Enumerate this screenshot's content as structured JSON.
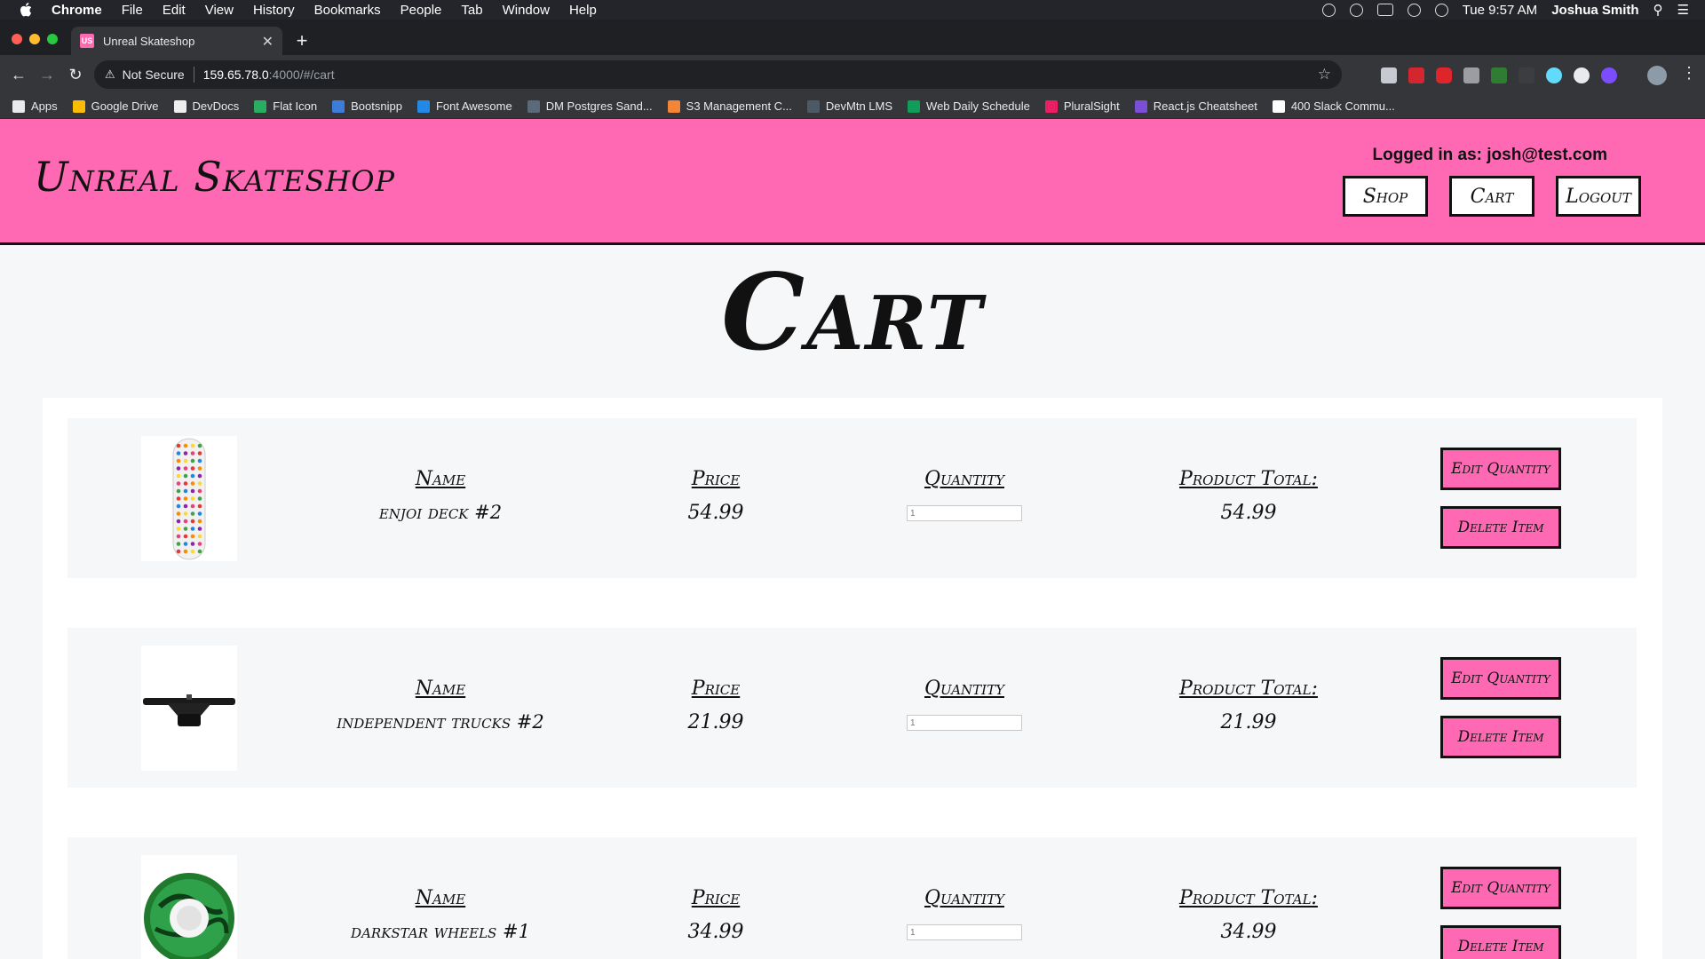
{
  "menubar": {
    "app": "Chrome",
    "items": [
      "File",
      "Edit",
      "View",
      "History",
      "Bookmarks",
      "People",
      "Tab",
      "Window",
      "Help"
    ],
    "clock": "Tue 9:57 AM",
    "user": "Joshua Smith"
  },
  "tab": {
    "title": "Unreal Skateshop",
    "favicon": "US"
  },
  "address": {
    "security": "Not Secure",
    "host": "159.65.78.0",
    "path": ":4000/#/cart"
  },
  "bookmarks": [
    {
      "label": "Apps",
      "color": "#e8eaed"
    },
    {
      "label": "Google Drive",
      "color": "#fbbc04"
    },
    {
      "label": "DevDocs",
      "color": "#eeeeee"
    },
    {
      "label": "Flat Icon",
      "color": "#27ae60"
    },
    {
      "label": "Bootsnipp",
      "color": "#3b7dd8"
    },
    {
      "label": "Font Awesome",
      "color": "#228ae6"
    },
    {
      "label": "DM Postgres Sand...",
      "color": "#5a6a7a"
    },
    {
      "label": "S3 Management C...",
      "color": "#f58536"
    },
    {
      "label": "DevMtn LMS",
      "color": "#4c5a68"
    },
    {
      "label": "Web Daily Schedule",
      "color": "#0f9d58"
    },
    {
      "label": "PluralSight",
      "color": "#e91e63"
    },
    {
      "label": "React.js Cheatsheet",
      "color": "#7a4fd6"
    },
    {
      "label": "400 Slack Commu...",
      "color": "#ffffff"
    }
  ],
  "site": {
    "title": "Unreal Skateshop",
    "logged_in": "Logged in as: josh@test.com",
    "nav": {
      "shop": "Shop",
      "cart": "Cart",
      "logout": "Logout"
    },
    "heading": "Cart",
    "accent": "#ff69b4"
  },
  "cart": {
    "labels": {
      "name": "Name",
      "price": "Price",
      "quantity": "Quantity",
      "total": "Product Total:"
    },
    "edit_label": "Edit Quantity",
    "delete_label": "Delete Item",
    "items": [
      {
        "name": "enjoi deck #2",
        "price": "54.99",
        "quantity": "1",
        "total": "54.99",
        "image": "skateboard-deck"
      },
      {
        "name": "independent trucks #2",
        "price": "21.99",
        "quantity": "1",
        "total": "21.99",
        "image": "skateboard-truck"
      },
      {
        "name": "darkstar wheels #1",
        "price": "34.99",
        "quantity": "1",
        "total": "34.99",
        "image": "skateboard-wheel"
      }
    ]
  }
}
